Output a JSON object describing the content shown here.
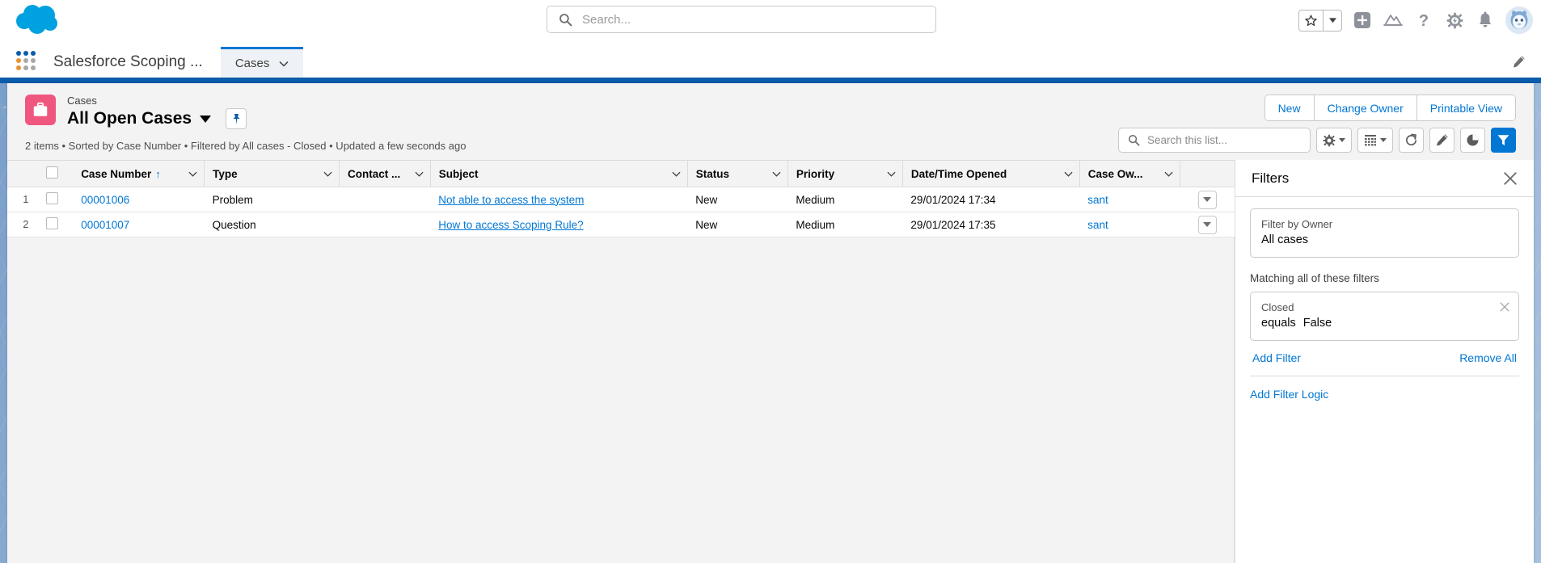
{
  "header": {
    "logo": "salesforce-cloud-logo",
    "search": {
      "placeholder": "Search...",
      "value": "",
      "icon": "search-icon"
    },
    "icons": [
      {
        "name": "favorites-star-icon",
        "glyph": "star"
      },
      {
        "name": "favorites-caret-icon",
        "glyph": "caret-down"
      },
      {
        "name": "global-actions-plus-icon",
        "glyph": "plus"
      },
      {
        "name": "einstein-mountain-icon",
        "glyph": "mountain"
      },
      {
        "name": "help-icon",
        "glyph": "question"
      },
      {
        "name": "setup-gear-icon",
        "glyph": "gear"
      },
      {
        "name": "notifications-bell-icon",
        "glyph": "bell"
      },
      {
        "name": "user-avatar",
        "glyph": "avatar"
      }
    ]
  },
  "nav": {
    "app_launcher": "app-launcher-icon",
    "app_name": "Salesforce Scoping ...",
    "tabs": [
      {
        "label": "Cases",
        "active": true
      }
    ],
    "edit_icon": "pencil-edit-icon"
  },
  "list_header": {
    "object_icon": "cases-briefcase-icon",
    "eyebrow": "Cases",
    "title": "All Open Cases",
    "pin_icon": "pin-icon",
    "meta": "2 items • Sorted by Case Number • Filtered by All cases - Closed • Updated a few seconds ago",
    "actions": [
      "New",
      "Change Owner",
      "Printable View"
    ]
  },
  "toolbar": {
    "search": {
      "placeholder": "Search this list...",
      "value": "",
      "icon": "search-icon"
    },
    "buttons": [
      {
        "name": "list-view-controls-button",
        "icon": "gear-icon",
        "caret": true
      },
      {
        "name": "display-as-button",
        "icon": "table-grid-icon",
        "caret": true
      },
      {
        "name": "refresh-button",
        "icon": "refresh-icon",
        "caret": false
      },
      {
        "name": "edit-list-button",
        "icon": "pencil-icon",
        "caret": false
      },
      {
        "name": "charts-button",
        "icon": "pie-chart-icon",
        "caret": false
      },
      {
        "name": "filters-button",
        "icon": "filter-funnel-icon",
        "caret": false,
        "active": true
      }
    ]
  },
  "table": {
    "columns": [
      {
        "label": "Case Number",
        "sorted": "asc"
      },
      {
        "label": "Type",
        "sorted": null
      },
      {
        "label": "Contact ...",
        "sorted": null
      },
      {
        "label": "Subject",
        "sorted": null
      },
      {
        "label": "Status",
        "sorted": null
      },
      {
        "label": "Priority",
        "sorted": null
      },
      {
        "label": "Date/Time Opened",
        "sorted": null
      },
      {
        "label": "Case Ow...",
        "sorted": null
      }
    ],
    "rows": [
      {
        "index": "1",
        "case_number": "00001006",
        "type": "Problem",
        "contact": "",
        "subject": "Not able to access the system",
        "status": "New",
        "priority": "Medium",
        "date_opened": "29/01/2024 17:34",
        "owner": "sant"
      },
      {
        "index": "2",
        "case_number": "00001007",
        "type": "Question",
        "contact": "",
        "subject": "How to access Scoping Rule?",
        "status": "New",
        "priority": "Medium",
        "date_opened": "29/01/2024 17:35",
        "owner": "sant"
      }
    ]
  },
  "filters": {
    "title": "Filters",
    "close_icon": "close-icon",
    "owner_filter": {
      "label": "Filter by Owner",
      "value": "All cases"
    },
    "matching_label": "Matching all of these filters",
    "filter_items": [
      {
        "field": "Closed",
        "operator": "equals",
        "value": "False"
      }
    ],
    "add_filter": "Add Filter",
    "remove_all": "Remove All",
    "add_filter_logic": "Add Filter Logic"
  },
  "colors": {
    "brand_blue": "#0176d3",
    "nav_strip": "#0b5cab",
    "case_pink": "#f0577f",
    "link_blue": "#0176d3"
  }
}
